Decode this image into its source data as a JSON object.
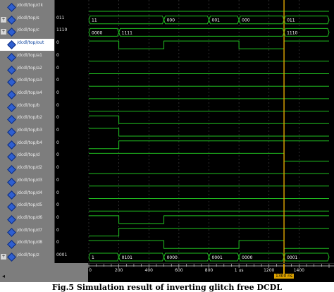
{
  "colors": {
    "signal": "#21c021",
    "bus": "#21c021",
    "cursor": "#e0a500",
    "grid": "#4c4c4c"
  },
  "signals": [
    {
      "name": "/dcdl/top/clk",
      "value": "",
      "expandable": false,
      "kind": "clock"
    },
    {
      "name": "/dcdl/top/s",
      "value": "011",
      "expandable": true,
      "kind": "bus",
      "segments": [
        {
          "t": 0,
          "label": "11"
        },
        {
          "t": 500,
          "label": "000"
        },
        {
          "t": 800,
          "label": "001"
        },
        {
          "t": 1000,
          "label": "000"
        },
        {
          "t": 1300,
          "label": "011"
        }
      ]
    },
    {
      "name": "/dcdl/top/c",
      "value": "1110",
      "expandable": true,
      "kind": "bus",
      "segments": [
        {
          "t": 0,
          "label": "0000"
        },
        {
          "t": 200,
          "label": "1111"
        },
        {
          "t": 1300,
          "label": "1110"
        }
      ]
    },
    {
      "name": "/dcdl/top/out",
      "value": "0",
      "expandable": false,
      "kind": "bit",
      "selected": true,
      "edges": [
        {
          "t": 0,
          "v": 1
        },
        {
          "t": 200,
          "v": 0
        },
        {
          "t": 500,
          "v": 1
        },
        {
          "t": 1000,
          "v": 0
        },
        {
          "t": 1300,
          "v": 1
        }
      ]
    },
    {
      "name": "/dcdl/top/a1",
      "value": "0",
      "expandable": false,
      "kind": "bit",
      "edges": [
        {
          "t": 0,
          "v": 0
        }
      ]
    },
    {
      "name": "/dcdl/top/a2",
      "value": "0",
      "expandable": false,
      "kind": "bit",
      "edges": [
        {
          "t": 0,
          "v": 0
        }
      ]
    },
    {
      "name": "/dcdl/top/a3",
      "value": "0",
      "expandable": false,
      "kind": "bit",
      "edges": [
        {
          "t": 0,
          "v": 0
        }
      ]
    },
    {
      "name": "/dcdl/top/a4",
      "value": "0",
      "expandable": false,
      "kind": "bit",
      "edges": [
        {
          "t": 0,
          "v": 0
        }
      ]
    },
    {
      "name": "/dcdl/top/b",
      "value": "0",
      "expandable": false,
      "kind": "bit",
      "edges": [
        {
          "t": 0,
          "v": 0
        }
      ]
    },
    {
      "name": "/dcdl/top/b2",
      "value": "0",
      "expandable": false,
      "kind": "bit",
      "edges": [
        {
          "t": 0,
          "v": 1
        },
        {
          "t": 200,
          "v": 0
        }
      ]
    },
    {
      "name": "/dcdl/top/b3",
      "value": "0",
      "expandable": false,
      "kind": "bit",
      "edges": [
        {
          "t": 0,
          "v": 1
        },
        {
          "t": 200,
          "v": 0
        }
      ]
    },
    {
      "name": "/dcdl/top/b4",
      "value": "0",
      "expandable": false,
      "kind": "bit",
      "edges": [
        {
          "t": 0,
          "v": 0
        },
        {
          "t": 200,
          "v": 1
        }
      ]
    },
    {
      "name": "/dcdl/top/d",
      "value": "0",
      "expandable": false,
      "kind": "bit",
      "edges": [
        {
          "t": 0,
          "v": 1
        },
        {
          "t": 1300,
          "v": 0
        }
      ]
    },
    {
      "name": "/dcdl/top/d2",
      "value": "0",
      "expandable": false,
      "kind": "bit",
      "edges": [
        {
          "t": 0,
          "v": 0
        }
      ]
    },
    {
      "name": "/dcdl/top/d3",
      "value": "0",
      "expandable": false,
      "kind": "bit",
      "edges": [
        {
          "t": 0,
          "v": 0
        }
      ]
    },
    {
      "name": "/dcdl/top/d4",
      "value": "0",
      "expandable": false,
      "kind": "bit",
      "edges": [
        {
          "t": 0,
          "v": 0
        }
      ]
    },
    {
      "name": "/dcdl/top/d5",
      "value": "0",
      "expandable": false,
      "kind": "bit",
      "edges": [
        {
          "t": 0,
          "v": 0
        }
      ]
    },
    {
      "name": "/dcdl/top/d6",
      "value": "0",
      "expandable": false,
      "kind": "bit",
      "edges": [
        {
          "t": 0,
          "v": 1
        },
        {
          "t": 200,
          "v": 0
        },
        {
          "t": 500,
          "v": 1
        }
      ]
    },
    {
      "name": "/dcdl/top/d7",
      "value": "0",
      "expandable": false,
      "kind": "bit",
      "edges": [
        {
          "t": 0,
          "v": 0
        },
        {
          "t": 200,
          "v": 1
        }
      ]
    },
    {
      "name": "/dcdl/top/d8",
      "value": "0",
      "expandable": false,
      "kind": "bit",
      "edges": [
        {
          "t": 0,
          "v": 1
        },
        {
          "t": 500,
          "v": 0
        },
        {
          "t": 1000,
          "v": 1
        },
        {
          "t": 1300,
          "v": 0
        }
      ]
    },
    {
      "name": "/dcdl/top/z",
      "value": "0001",
      "expandable": true,
      "kind": "bus",
      "segments": [
        {
          "t": 0,
          "label": "1"
        },
        {
          "t": 200,
          "label": "0101"
        },
        {
          "t": 500,
          "label": "0000"
        },
        {
          "t": 800,
          "label": "0001"
        },
        {
          "t": 1000,
          "label": "0000"
        },
        {
          "t": 1300,
          "label": "0001"
        }
      ]
    }
  ],
  "ruler": {
    "ticks": [
      {
        "t": 0,
        "label": "0"
      },
      {
        "t": 200,
        "label": "200"
      },
      {
        "t": 400,
        "label": "400"
      },
      {
        "t": 600,
        "label": "600"
      },
      {
        "t": 800,
        "label": "800"
      },
      {
        "t": 1000,
        "label": "1 us"
      },
      {
        "t": 1200,
        "label": "1200"
      },
      {
        "t": 1400,
        "label": "1400"
      }
    ],
    "max_time": 1600,
    "cursor_time": 1300,
    "cursor_label": "1300 ns"
  },
  "caption": "Fig.5 Simulation result of inverting glitch free DCDL"
}
